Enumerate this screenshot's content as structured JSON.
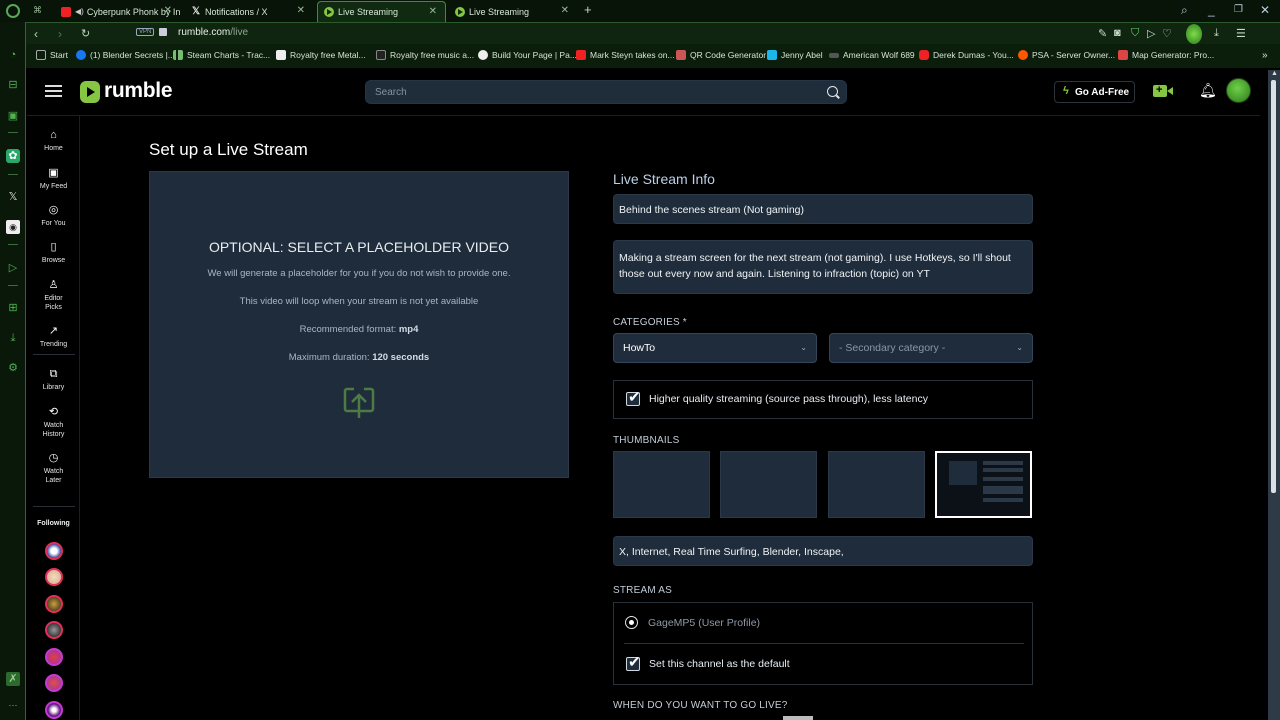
{
  "browser": {
    "tabs": [
      {
        "label": "Cyberpunk Phonk by In",
        "icon": "youtube-icon",
        "active": false
      },
      {
        "label": "Notifications / X",
        "icon": "x-icon",
        "active": false
      },
      {
        "label": "Live Streaming",
        "icon": "rumble-icon",
        "active": true
      },
      {
        "label": "Live Streaming",
        "icon": "rumble-icon",
        "active": false
      }
    ],
    "url_host": "rumble.com",
    "url_path": "/live",
    "vpn_label": "VPN",
    "bookmarks": [
      {
        "label": "Start",
        "icon": "folder-icon"
      },
      {
        "label": "(1) Blender Secrets |...",
        "icon": "facebook-icon"
      },
      {
        "label": "Steam Charts - Trac...",
        "icon": "chart-icon"
      },
      {
        "label": "Royalty free Metal...",
        "icon": "music-icon"
      },
      {
        "label": "Royalty free music a...",
        "icon": "music-icon"
      },
      {
        "label": "Build Your Page | Pa...",
        "icon": "page-icon"
      },
      {
        "label": "Mark Steyn takes on...",
        "icon": "youtube-icon"
      },
      {
        "label": "QR Code Generator",
        "icon": "qr-icon"
      },
      {
        "label": "Jenny Abel",
        "icon": "vimeo-icon"
      },
      {
        "label": "American Wolf 689",
        "icon": "wolf-icon"
      },
      {
        "label": "Derek Dumas - You...",
        "icon": "youtube-icon"
      },
      {
        "label": "PSA - Server Owner...",
        "icon": "reddit-icon"
      },
      {
        "label": "Map Generator: Pro...",
        "icon": "map-icon"
      }
    ],
    "bookmarks_overflow": "»"
  },
  "header": {
    "logo_text": "rumble",
    "search_placeholder": "Search",
    "ad_free_label": "Go Ad-Free"
  },
  "nav": {
    "items": [
      {
        "label": "Home"
      },
      {
        "label": "My Feed"
      },
      {
        "label": "For You"
      },
      {
        "label": "Browse"
      },
      {
        "label": "Editor Picks"
      },
      {
        "label": "Trending"
      },
      {
        "label": "Library"
      },
      {
        "label": "Watch History"
      },
      {
        "label": "Watch Later"
      }
    ],
    "following_label": "Following",
    "following_count_visible": 7
  },
  "page": {
    "title": "Set up a Live Stream",
    "placeholder": {
      "heading": "OPTIONAL: SELECT A PLACEHOLDER VIDEO",
      "line1": "We will generate a placeholder for you if you do not wish to provide one.",
      "line2": "This video will loop when your stream is not yet available",
      "format_label": "Recommended format: ",
      "format_value": "mp4",
      "duration_label": "Maximum duration: ",
      "duration_value": "120 seconds"
    },
    "info": {
      "heading": "Live Stream Info",
      "title_value": "Behind the scenes stream (Not gaming)",
      "description_value": "Making a stream screen for the next stream (not gaming). I use Hotkeys, so I'll shout those out every now and again. Listening to infraction (topic) on YT",
      "categories_label": "CATEGORIES *",
      "primary_category": "HowTo",
      "secondary_category_placeholder": "- Secondary category -",
      "hq_label": "Higher quality streaming (source pass through), less latency",
      "hq_checked": true,
      "thumbnails_label": "THUMBNAILS",
      "thumbnail_count": 4,
      "selected_thumbnail": 4,
      "tags_value": "X, Internet, Real Time Surfing, Blender, Inscape,",
      "stream_as_label": "STREAM AS",
      "stream_as_option": "GageMP5 (User Profile)",
      "default_channel_label": "Set this channel as the default",
      "default_channel_checked": true,
      "when_live_label": "WHEN DO YOU WANT TO GO LIVE?"
    }
  },
  "colors": {
    "brand": "#85c742",
    "field_bg": "#1f2c3b",
    "opera_accent": "#4fb24f"
  }
}
